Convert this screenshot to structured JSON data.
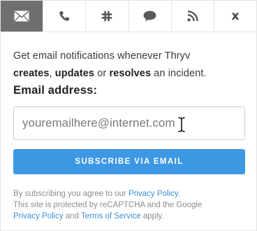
{
  "tabs": [
    {
      "icon": "envelope-icon",
      "active": true
    },
    {
      "icon": "phone-icon",
      "active": false
    },
    {
      "icon": "slack-icon",
      "active": false
    },
    {
      "icon": "chat-bubble-icon",
      "active": false
    },
    {
      "icon": "rss-icon",
      "active": false
    }
  ],
  "close_label": "x",
  "description": {
    "part1": "Get email notifications whenever Thryv",
    "creates": "creates",
    "comma": ",",
    "updates": "updates",
    "or": "or",
    "resolves": "resolves",
    "part2": "an incident."
  },
  "email_label": "Email address:",
  "email_input": {
    "placeholder": "youremailhere@internet.com",
    "value": ""
  },
  "subscribe_label": "SUBSCRIBE VIA EMAIL",
  "legal": {
    "line1_prefix": "By subscribing you agree to our",
    "privacy_link_1": "Privacy Policy",
    "line1_suffix": ".",
    "line2": "This site is protected by reCAPTCHA and the Google",
    "privacy_link_2": "Privacy Policy",
    "and": "and",
    "terms_link": "Terms of Service",
    "apply": "apply."
  },
  "colors": {
    "accent": "#3d98e3",
    "active_tab": "#6f6f6f",
    "link": "#3d8fd6"
  }
}
